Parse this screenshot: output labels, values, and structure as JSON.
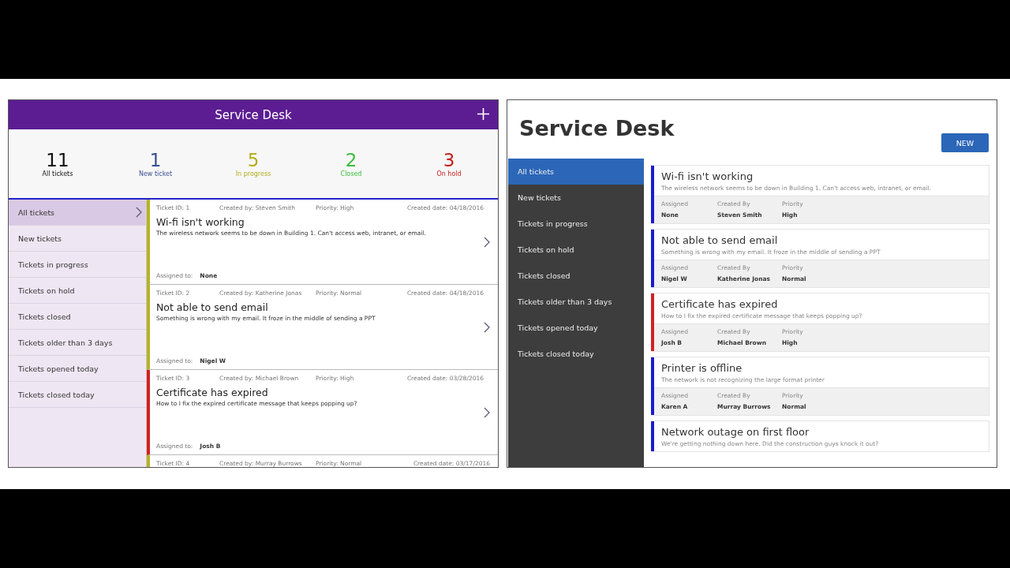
{
  "left_app": {
    "header": {
      "title": "Service Desk"
    },
    "stats": [
      {
        "count": "11",
        "label": "All tickets",
        "color": "#111111"
      },
      {
        "count": "1",
        "label": "New ticket",
        "color": "#3a4f93"
      },
      {
        "count": "5",
        "label": "In progress",
        "color": "#b3ae1e"
      },
      {
        "count": "2",
        "label": "Closed",
        "color": "#3cbf3c"
      },
      {
        "count": "3",
        "label": "On hold",
        "color": "#c8201e"
      }
    ],
    "sidebar": {
      "items": [
        {
          "label": "All tickets",
          "selected": true
        },
        {
          "label": "New tickets",
          "selected": false
        },
        {
          "label": "Tickets in progress",
          "selected": false
        },
        {
          "label": "Tickets on hold",
          "selected": false
        },
        {
          "label": "Tickets closed",
          "selected": false
        },
        {
          "label": "Tickets older than 3 days",
          "selected": false
        },
        {
          "label": "Tickets opened today",
          "selected": false
        },
        {
          "label": "Tickets closed today",
          "selected": false
        }
      ]
    },
    "tickets": [
      {
        "ticket_id": "Ticket ID: 1",
        "created_by": "Created by: Steven Smith",
        "priority": "Priority: High",
        "created_date": "Created date: 04/18/2016",
        "title": "Wi-fi isn't working",
        "description": "The wireless network seems to be down in Building 1. Can't access web, intranet, or email.",
        "assigned_label": "Assigned to:",
        "assigned": "None",
        "color": "#b5b41e"
      },
      {
        "ticket_id": "Ticket ID: 2",
        "created_by": "Created by: Katherine Jonas",
        "priority": "Priority: Normal",
        "created_date": "Created date: 04/18/2016",
        "title": "Not able to send email",
        "description": "Something is wrong with my email. It froze in the middle of sending a PPT",
        "assigned_label": "Assigned to:",
        "assigned": "Nigel W",
        "color": "#b5b41e"
      },
      {
        "ticket_id": "Ticket ID: 3",
        "created_by": "Created by: Michael Brown",
        "priority": "Priority: High",
        "created_date": "Created date: 03/28/2016",
        "title": "Certificate has expired",
        "description": "How to I fix the expired certificate message that keeps popping up?",
        "assigned_label": "Assigned to:",
        "assigned": "Josh B",
        "color": "#d42020"
      },
      {
        "ticket_id": "Ticket ID: 4",
        "created_by": "Created by: Murray Burrows",
        "priority": "Priority: Normal",
        "created_date": "Created date: 03/17/2016",
        "color": "#b5b41e"
      }
    ]
  },
  "right_app": {
    "title": "Service Desk",
    "new_button": "NEW",
    "sidebar": {
      "items": [
        {
          "label": "All tickets",
          "selected": true
        },
        {
          "label": "New tickets",
          "selected": false
        },
        {
          "label": "Tickets in progress",
          "selected": false
        },
        {
          "label": "Tickets on hold",
          "selected": false
        },
        {
          "label": "Tickets closed",
          "selected": false
        },
        {
          "label": "Tickets older than 3 days",
          "selected": false
        },
        {
          "label": "Tickets opened today",
          "selected": false
        },
        {
          "label": "Tickets closed today",
          "selected": false
        }
      ]
    },
    "tickets": [
      {
        "title": "Wi-fi isn't working",
        "description": "The wireless network seems to be down in Building 1. Can't access web, intranet, or email.",
        "color": "#1a1ad0",
        "fields": [
          {
            "label": "Assigned",
            "value": "None"
          },
          {
            "label": "Created By",
            "value": "Steven Smith"
          },
          {
            "label": "Priority",
            "value": "High"
          }
        ]
      },
      {
        "title": "Not able to send email",
        "description": "Something is wrong with my email. It froze in the middle of sending a PPT",
        "color": "#1a1ad0",
        "fields": [
          {
            "label": "Assigned",
            "value": "Nigel W"
          },
          {
            "label": "Created By",
            "value": "Katherine Jonas"
          },
          {
            "label": "Priority",
            "value": "Normal"
          }
        ]
      },
      {
        "title": "Certificate has expired",
        "description": "How to I fix the expired certificate message that keeps popping up?",
        "color": "#d42020",
        "fields": [
          {
            "label": "Assigned",
            "value": "Josh B"
          },
          {
            "label": "Created By",
            "value": "Michael Brown"
          },
          {
            "label": "Priority",
            "value": "High"
          }
        ]
      },
      {
        "title": "Printer is offline",
        "description": "The network is not recognizing the large format printer",
        "color": "#1a1ad0",
        "fields": [
          {
            "label": "Assigned",
            "value": "Karen A"
          },
          {
            "label": "Created By",
            "value": "Murray Burrows"
          },
          {
            "label": "Priority",
            "value": "Normal"
          }
        ]
      },
      {
        "title": "Network outage on first floor",
        "description": "We're getting nothing down here. Did the construction guys knock it out?",
        "color": "#1a1ad0"
      }
    ]
  }
}
